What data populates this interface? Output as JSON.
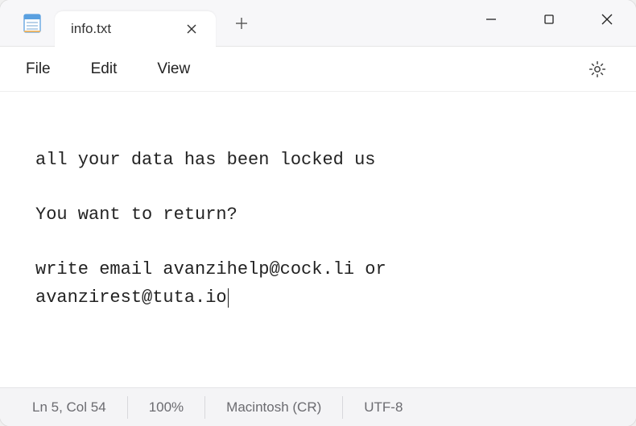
{
  "tab": {
    "title": "info.txt"
  },
  "menu": {
    "file": "File",
    "edit": "Edit",
    "view": "View"
  },
  "content": {
    "line1": "all your data has been locked us",
    "line3": "You want to return?",
    "line5a": "write email avanzihelp@cock.li or",
    "line5b": "avanzirest@tuta.io"
  },
  "status": {
    "position": "Ln 5, Col 54",
    "zoom": "100%",
    "lineending": "Macintosh (CR)",
    "encoding": "UTF-8"
  }
}
